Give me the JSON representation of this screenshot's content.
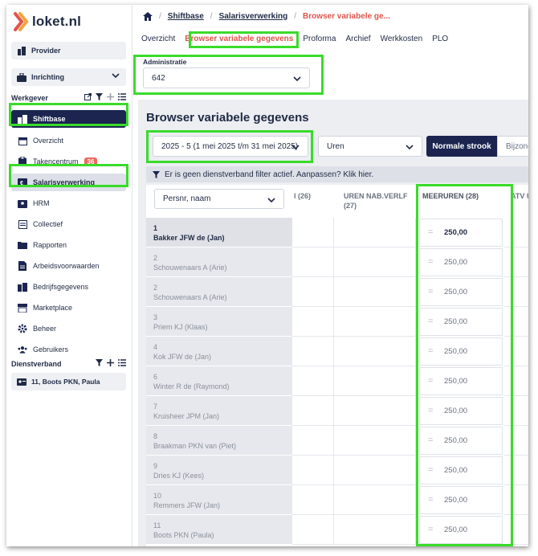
{
  "app": {
    "logo_text": "loket.nl"
  },
  "sidebar": {
    "provider": "Provider",
    "inrichting": "Inrichting",
    "werkgever_title": "Werkgever",
    "items": [
      {
        "label": "Shiftbase",
        "icon": "building-icon"
      },
      {
        "label": "Overzicht",
        "icon": "calendar-icon"
      },
      {
        "label": "Takencentrum",
        "icon": "clipboard-icon",
        "badge": "36"
      },
      {
        "label": "Salarisverwerking",
        "icon": "money-icon"
      },
      {
        "label": "HRM",
        "icon": "id-card-icon"
      },
      {
        "label": "Collectief",
        "icon": "layers-icon"
      },
      {
        "label": "Rapporten",
        "icon": "folder-icon"
      },
      {
        "label": "Arbeidsvoorwaarden",
        "icon": "document-icon"
      },
      {
        "label": "Bedrijfsgegevens",
        "icon": "buildings-icon"
      },
      {
        "label": "Marketplace",
        "icon": "store-icon"
      },
      {
        "label": "Beheer",
        "icon": "gear-icon"
      },
      {
        "label": "Gebruikers",
        "icon": "users-icon"
      }
    ],
    "dienstverband_title": "Dienstverband",
    "employee": "11, Boots PKN, Paula"
  },
  "breadcrumb": {
    "items": [
      "Shiftbase",
      "Salarisverwerking"
    ],
    "current": "Browser variabele ge..."
  },
  "tabs": [
    "Overzicht",
    "Browser variabele gegevens",
    "Proforma",
    "Archief",
    "Werkkosten",
    "PLO"
  ],
  "administratie": {
    "label": "Administratie",
    "value": "642"
  },
  "page": {
    "title": "Browser variabele gegevens",
    "period": "2025 - 5 (1 mei 2025 t/m 31 mei 2025)",
    "unit": "Uren",
    "strook_active": "Normale strook",
    "strook_other": "Bijzonde",
    "filter_notice": "Er is geen dienstverband filter actief. Aanpassen? Klik hier."
  },
  "grid": {
    "sort_select": "Persnr, naam",
    "columns": [
      "l (26)",
      "UREN NAB.VERLF (27)",
      "MEERUREN (28)",
      "ATV U"
    ],
    "rows": [
      {
        "nr": "1",
        "name": "Bakker JFW de (Jan)",
        "value": "250,00"
      },
      {
        "nr": "2",
        "name": "Schouwenaars A (Arie)",
        "value": "250,00"
      },
      {
        "nr": "2",
        "name": "Schouwenaars A (Arie)",
        "value": "250,00"
      },
      {
        "nr": "3",
        "name": "Priem KJ (Klaas)",
        "value": "250,00"
      },
      {
        "nr": "4",
        "name": "Kok JFW de (Jan)",
        "value": "250,00"
      },
      {
        "nr": "6",
        "name": "Winter R de (Raymond)",
        "value": "250,00"
      },
      {
        "nr": "7",
        "name": "Kruisheer JPM (Jan)",
        "value": "250,00"
      },
      {
        "nr": "8",
        "name": "Braakman PKN van (Piet)",
        "value": "250,00"
      },
      {
        "nr": "9",
        "name": "Dries KJ (Kees)",
        "value": "250,00"
      },
      {
        "nr": "10",
        "name": "Remmers JFW (Jan)",
        "value": "250,00"
      },
      {
        "nr": "11",
        "name": "Boots PKN (Paula)",
        "value": "250,00"
      }
    ]
  },
  "colors": {
    "navy": "#1b2550",
    "accent": "#e0544b",
    "highlight": "#3adb2a",
    "badge": "#ee6a5f"
  }
}
